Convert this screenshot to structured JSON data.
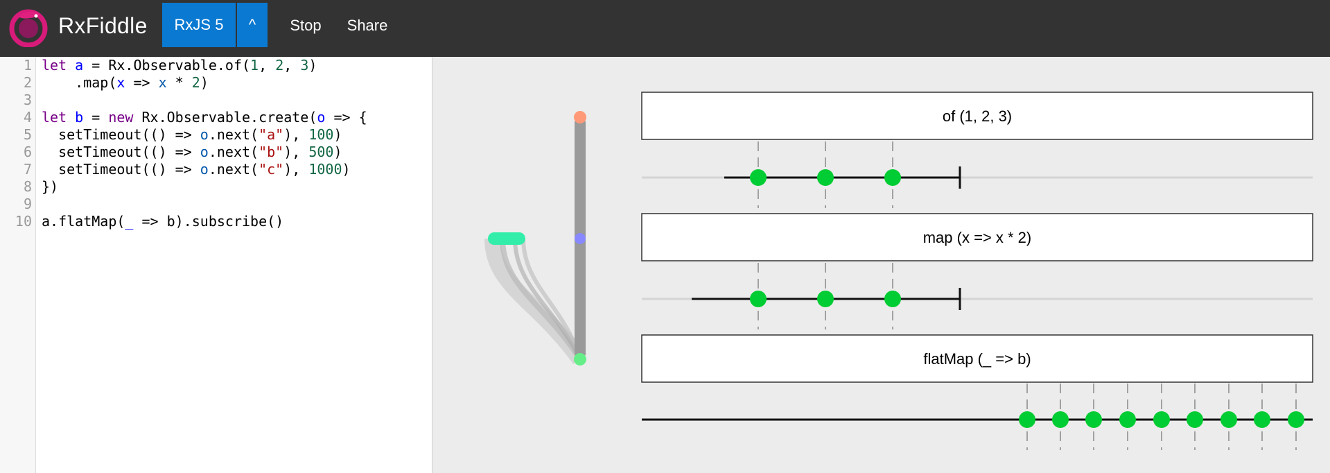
{
  "app": {
    "title": "RxFiddle",
    "logo_icon": "rxjs-logo-icon"
  },
  "toolbar": {
    "version_label": "RxJS 5",
    "caret_label": "^",
    "stop_label": "Stop",
    "share_label": "Share"
  },
  "colors": {
    "topbar": "#333333",
    "button_blue": "#0a79d1",
    "event_green": "#00cc33",
    "start_orange": "#ff9977",
    "mid_blue": "#8888ff",
    "end_green": "#66ee88",
    "teal": "#33eeaa"
  },
  "editor": {
    "lines": [
      {
        "no": "1",
        "tokens": [
          [
            "let",
            "kw"
          ],
          [
            " ",
            "plain"
          ],
          [
            "a",
            "def"
          ],
          [
            " = Rx.Observable.of(",
            "plain"
          ],
          [
            "1",
            "num"
          ],
          [
            ", ",
            "plain"
          ],
          [
            "2",
            "num"
          ],
          [
            ", ",
            "plain"
          ],
          [
            "3",
            "num"
          ],
          [
            ")",
            "plain"
          ]
        ]
      },
      {
        "no": "2",
        "tokens": [
          [
            "    .map(",
            "plain"
          ],
          [
            "x",
            "def"
          ],
          [
            " => ",
            "plain"
          ],
          [
            "x",
            "var"
          ],
          [
            " * ",
            "plain"
          ],
          [
            "2",
            "num"
          ],
          [
            ")",
            "plain"
          ]
        ]
      },
      {
        "no": "3",
        "tokens": []
      },
      {
        "no": "4",
        "tokens": [
          [
            "let",
            "kw"
          ],
          [
            " ",
            "plain"
          ],
          [
            "b",
            "def"
          ],
          [
            " = ",
            "plain"
          ],
          [
            "new",
            "kw"
          ],
          [
            " Rx.Observable.create(",
            "plain"
          ],
          [
            "o",
            "def"
          ],
          [
            " => {",
            "plain"
          ]
        ]
      },
      {
        "no": "5",
        "tokens": [
          [
            "  setTimeout(() => ",
            "plain"
          ],
          [
            "o",
            "var"
          ],
          [
            ".next(",
            "plain"
          ],
          [
            "\"a\"",
            "str"
          ],
          [
            "), ",
            "plain"
          ],
          [
            "100",
            "num"
          ],
          [
            ")",
            "plain"
          ]
        ]
      },
      {
        "no": "6",
        "tokens": [
          [
            "  setTimeout(() => ",
            "plain"
          ],
          [
            "o",
            "var"
          ],
          [
            ".next(",
            "plain"
          ],
          [
            "\"b\"",
            "str"
          ],
          [
            "), ",
            "plain"
          ],
          [
            "500",
            "num"
          ],
          [
            ")",
            "plain"
          ]
        ]
      },
      {
        "no": "7",
        "tokens": [
          [
            "  setTimeout(() => ",
            "plain"
          ],
          [
            "o",
            "var"
          ],
          [
            ".next(",
            "plain"
          ],
          [
            "\"c\"",
            "str"
          ],
          [
            "), ",
            "plain"
          ],
          [
            "1000",
            "num"
          ],
          [
            ")",
            "plain"
          ]
        ]
      },
      {
        "no": "8",
        "tokens": [
          [
            "})",
            "plain"
          ]
        ]
      },
      {
        "no": "9",
        "tokens": []
      },
      {
        "no": "10",
        "tokens": [
          [
            "a.flatMap(",
            "plain"
          ],
          [
            "_",
            "def"
          ],
          [
            " => b).subscribe()",
            "plain"
          ]
        ]
      }
    ]
  },
  "operators": [
    {
      "label": "of (1, 2, 3)",
      "events": 3,
      "completed": true
    },
    {
      "label": "map (x => x * 2)",
      "events": 3,
      "completed": true
    },
    {
      "label": "flatMap (_ => b)",
      "events": 9,
      "completed": false
    }
  ]
}
